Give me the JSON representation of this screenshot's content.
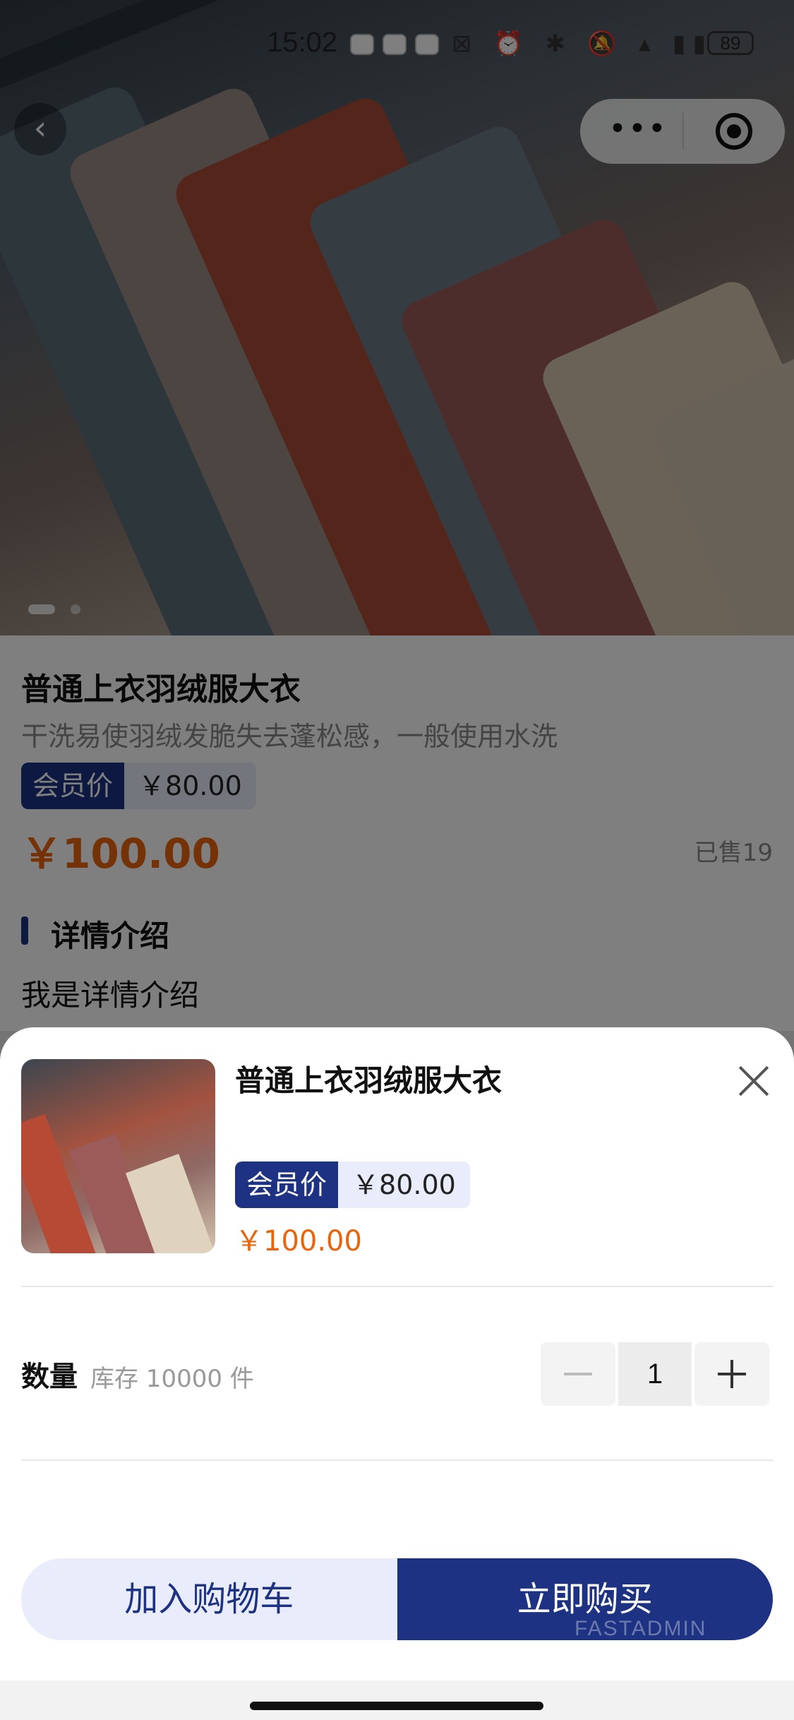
{
  "status_bar": {
    "time": "15:02",
    "battery": "89"
  },
  "hero": {
    "slide_count": 2,
    "active_slide": 1
  },
  "product": {
    "title": "普通上衣羽绒服大衣",
    "description": "干洗易使羽绒发脆失去蓬松感，一般使用水洗",
    "vip_label": "会员价",
    "vip_price": "￥80.00",
    "price": "￥100.00",
    "sold": "已售19",
    "detail_heading": "详情介绍",
    "detail_text": "我是详情介绍"
  },
  "sheet": {
    "title": "普通上衣羽绒服大衣",
    "vip_label": "会员价",
    "vip_price": "￥80.00",
    "price": "￥100.00",
    "quantity_label": "数量",
    "stock_text": "库存 10000 件",
    "quantity": "1",
    "add_to_cart": "加入购物车",
    "buy_now": "立即购买"
  },
  "watermark": "FASTADMIN",
  "colors": {
    "brand": "#1d3282",
    "price": "#e8650c",
    "vip_bg": "#e8ecfb"
  }
}
